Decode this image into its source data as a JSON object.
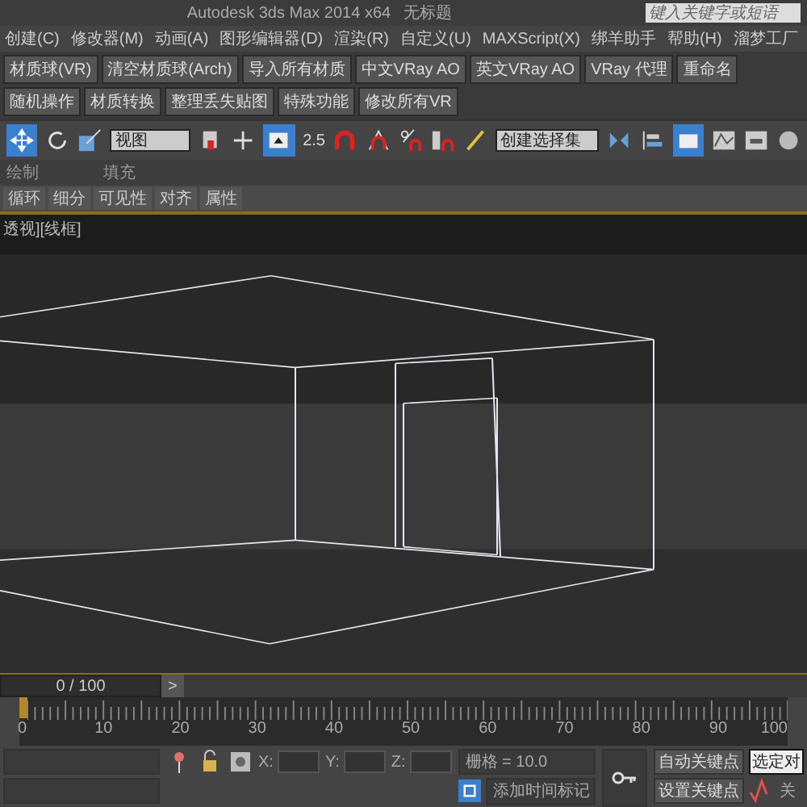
{
  "title_bar": {
    "title": "Autodesk 3ds Max  2014 x64",
    "document": "无标题",
    "search_placeholder": "键入关键字或短语"
  },
  "menu": [
    "创建(C)",
    "修改器(M)",
    "动画(A)",
    "图形编辑器(D)",
    "渲染(R)",
    "自定义(U)",
    "MAXScript(X)",
    "绑羊助手",
    "帮助(H)",
    "溜梦工厂"
  ],
  "script_buttons": [
    "材质球(VR)",
    "清空材质球(Arch)",
    "导入所有材质",
    "中文VRay AO",
    "英文VRay AO",
    "VRay 代理",
    "重命名",
    "随机操作",
    "材质转换",
    "整理丢失贴图",
    "特殊功能",
    "修改所有VR"
  ],
  "main_toolbar": {
    "view_dropdown": "视图",
    "snap_label": "2.5",
    "selection_set": "创建选择集"
  },
  "ribbon": {
    "panels": [
      "绘制",
      "填充"
    ],
    "tabs": [
      "循环",
      "细分",
      "可见性",
      "对齐",
      "属性"
    ]
  },
  "viewport": {
    "label": "透视][线框]"
  },
  "time_slider": {
    "label": "0 / 100",
    "next": ">",
    "level": 0
  },
  "track_ticks": [
    "0",
    "10",
    "20",
    "30",
    "40",
    "50",
    "60",
    "70",
    "80",
    "90",
    "100"
  ],
  "status": {
    "x_label": "X:",
    "y_label": "Y:",
    "z_label": "Z:",
    "grid": "栅格 = 10.0",
    "add_tag": "添加时间标记",
    "auto_key": "自动关键点",
    "set_key": "设置关键点",
    "selected": "选定对",
    "filter": "关"
  }
}
